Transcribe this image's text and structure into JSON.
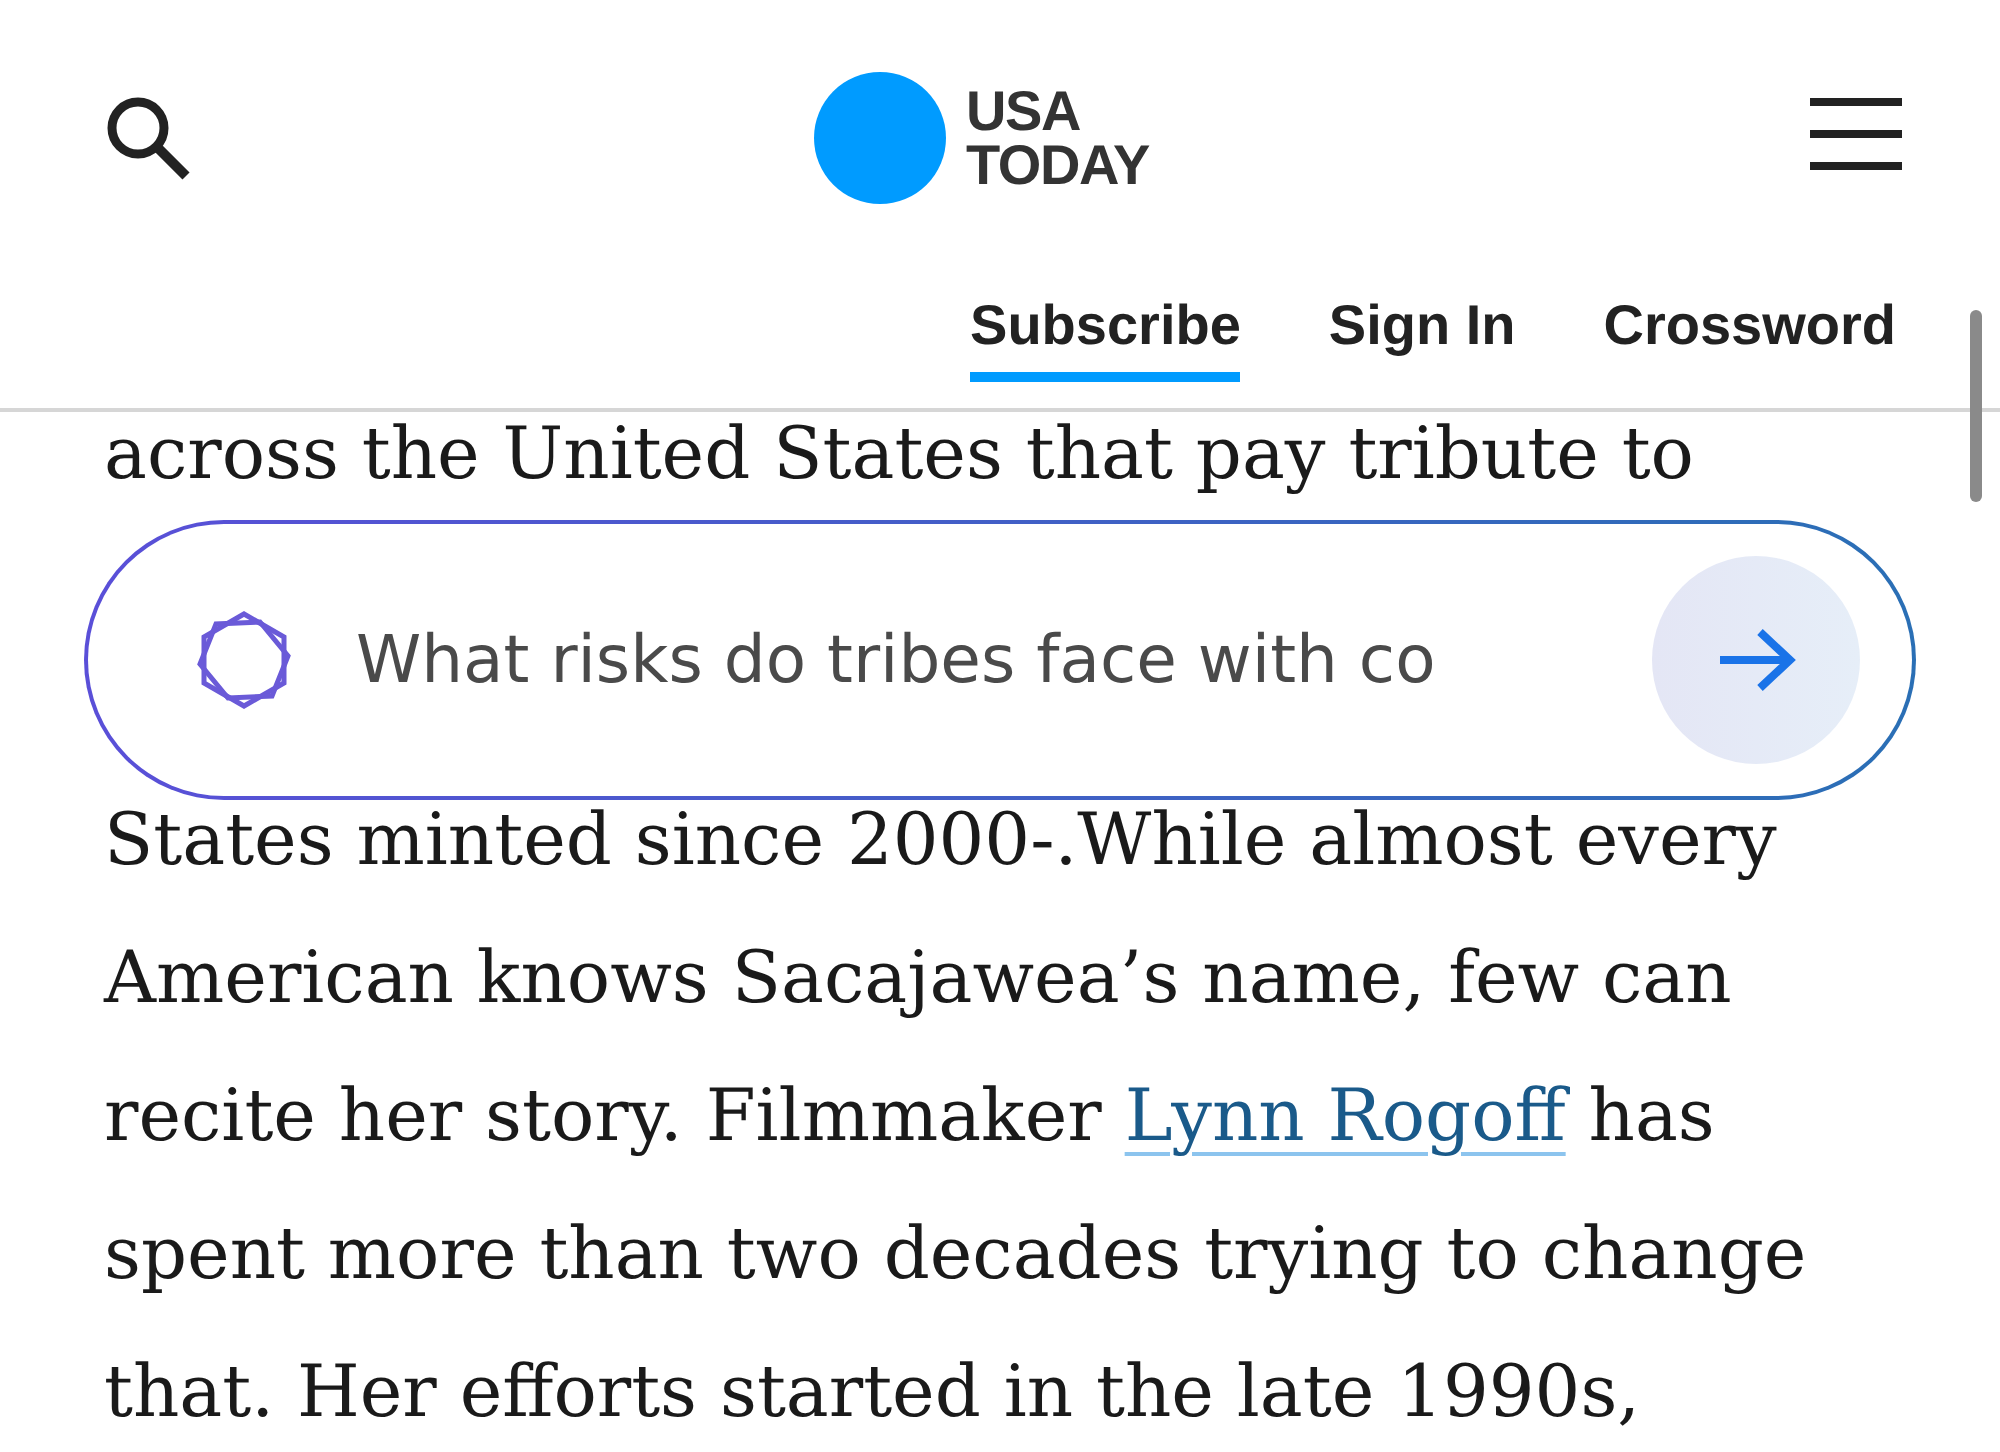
{
  "header": {
    "logo": {
      "line_1": "USA",
      "line_2": "TODAY"
    },
    "nav": [
      {
        "label": "Subscribe",
        "selected": true
      },
      {
        "label": "Sign In",
        "selected": false
      },
      {
        "label": "Crossword",
        "selected": false
      }
    ]
  },
  "article": {
    "clipped_line": "across the United States that pay tribute to",
    "paragraph": [
      {
        "kind": "text",
        "text": "States minted since 2000-.While almost every American knows Sacajawea’s name, few can recite her story. Filmmaker "
      },
      {
        "kind": "link",
        "text": "Lynn Rogoff"
      },
      {
        "kind": "text",
        "text": " has spent more than two decades trying to change that. Her efforts started in the late 1990s,"
      }
    ]
  },
  "ask_bar": {
    "placeholder": "What risks do tribes face with co"
  }
}
